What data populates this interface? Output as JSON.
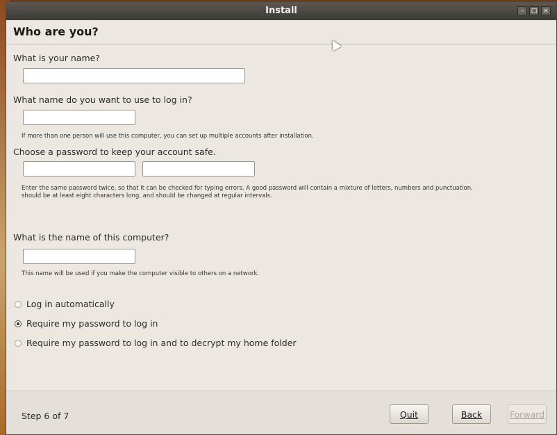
{
  "window": {
    "title": "Install",
    "controls": [
      "minimize",
      "maximize",
      "close"
    ]
  },
  "page": {
    "heading": "Who are you?",
    "name_question": "What is your name?",
    "name_value": "",
    "login_question": "What name do you want to use to log in?",
    "login_value": "",
    "login_note": "If more than one person will use this computer, you can set up multiple accounts after installation.",
    "password_question": "Choose a password to keep your account safe.",
    "password_value": "",
    "password_confirm_value": "",
    "password_note": "Enter the same password twice, so that it can be checked for typing errors. A good password will contain a mixture of letters, numbers and punctuation, should be at least eight characters long, and should be changed at regular intervals.",
    "computer_question": "What is the name of this computer?",
    "computer_value": "",
    "computer_note": "This name will be used if you make the computer visible to others on a network."
  },
  "login_options": {
    "options": [
      {
        "label": "Log in automatically",
        "selected": false
      },
      {
        "label": "Require my password to log in",
        "selected": true
      },
      {
        "label": "Require my password to log in and to decrypt my home folder",
        "selected": false
      }
    ]
  },
  "footer": {
    "step": "Step 6 of 7",
    "quit": "Quit",
    "back": "Back",
    "forward": "Forward"
  }
}
